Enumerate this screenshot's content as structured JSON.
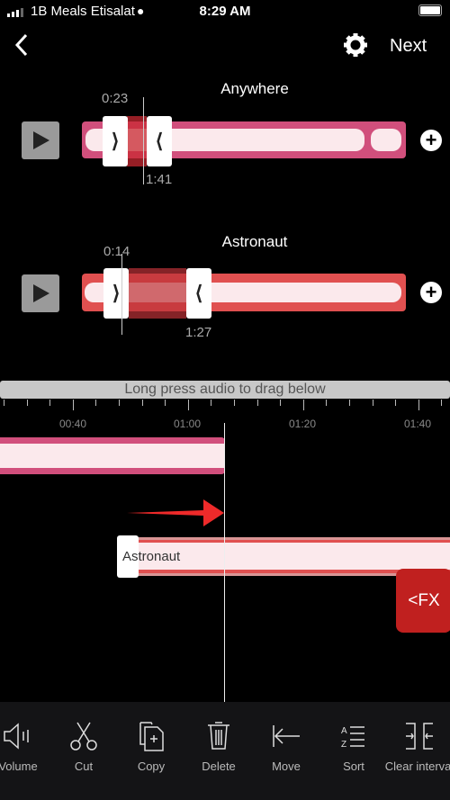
{
  "status_bar": {
    "carrier": "1B Meals Etisalat",
    "time": "8:29 AM"
  },
  "nav": {
    "next_label": "Next"
  },
  "tracks": [
    {
      "title": "Anywhere",
      "start": "0:23",
      "end": "1:41",
      "color": "#d14f7c"
    },
    {
      "title": "Astronaut",
      "start": "0:14",
      "end": "1:27",
      "color": "#e05050"
    }
  ],
  "hint": "Long press audio to drag below",
  "timeline": {
    "labels": [
      "00:40",
      "01:00",
      "01:20",
      "01:40"
    ],
    "clip_label": "Astronaut"
  },
  "fx_label": "<FX",
  "toolbar": [
    {
      "label": "Volume",
      "icon": "volume-icon"
    },
    {
      "label": "Cut",
      "icon": "scissors-icon"
    },
    {
      "label": "Copy",
      "icon": "copy-icon"
    },
    {
      "label": "Delete",
      "icon": "trash-icon"
    },
    {
      "label": "Move",
      "icon": "move-left-icon"
    },
    {
      "label": "Sort",
      "icon": "sort-az-icon"
    },
    {
      "label": "Clear interval",
      "icon": "clear-interval-icon"
    }
  ]
}
